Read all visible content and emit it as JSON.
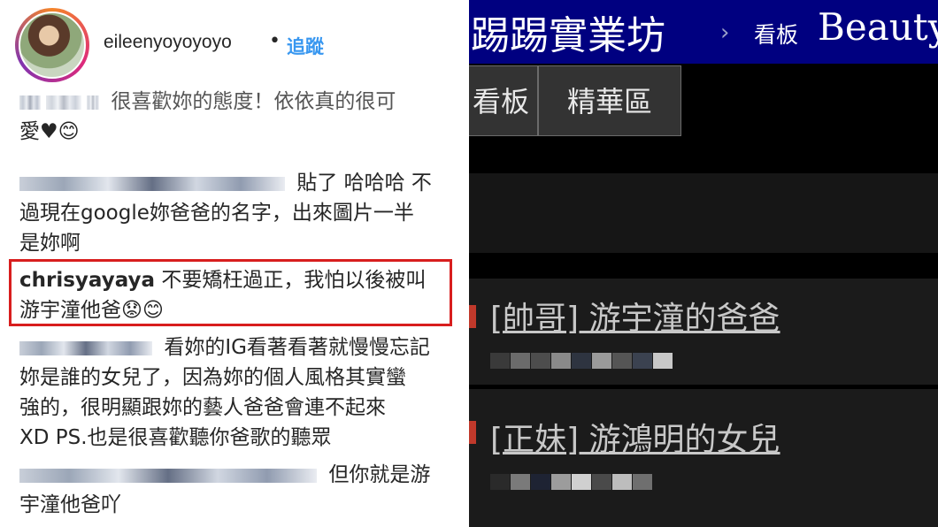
{
  "instagram": {
    "username": "eileenyoyoyoyo",
    "separator": "•",
    "follow_label": "追蹤",
    "comments": [
      {
        "user_hidden": true,
        "lines": [
          "很喜歡妳的態度！依依真的很可",
          "愛♥😊"
        ]
      },
      {
        "user_hidden": true,
        "lines": [
          "貼了 哈哈哈 不",
          "過現在google妳爸爸的名字，出來圖片一半",
          "是妳啊"
        ]
      },
      {
        "user": "chrisyayaya",
        "lines": [
          "不要矯枉過正，我怕以後被叫",
          "游宇潼他爸😟😊"
        ]
      },
      {
        "user_hidden": true,
        "lines": [
          "看妳的IG看著看著就慢慢忘記",
          "妳是誰的女兒了，因為妳的個人風格其實蠻",
          "強的，很明顯跟妳的藝人爸爸會連不起來",
          "XD PS.也是很喜歡聽你爸歌的聽眾"
        ]
      },
      {
        "user_hidden": true,
        "lines": [
          "但你就是游",
          "宇潼他爸吖"
        ]
      }
    ]
  },
  "ptt": {
    "site_title": "踢踢實業坊",
    "breadcrumb_sep": "›",
    "board_label": "看板",
    "board_name": "Beauty",
    "tabs": [
      "看板",
      "精華區"
    ],
    "posts": [
      {
        "title": "[帥哥] 游宇潼的爸爸"
      },
      {
        "title": "[正妹] 游鴻明的女兒"
      }
    ]
  },
  "colors": {
    "ig_follow": "#3897f0",
    "highlight_border": "#d81e1e",
    "ptt_topbar": "#000080"
  }
}
